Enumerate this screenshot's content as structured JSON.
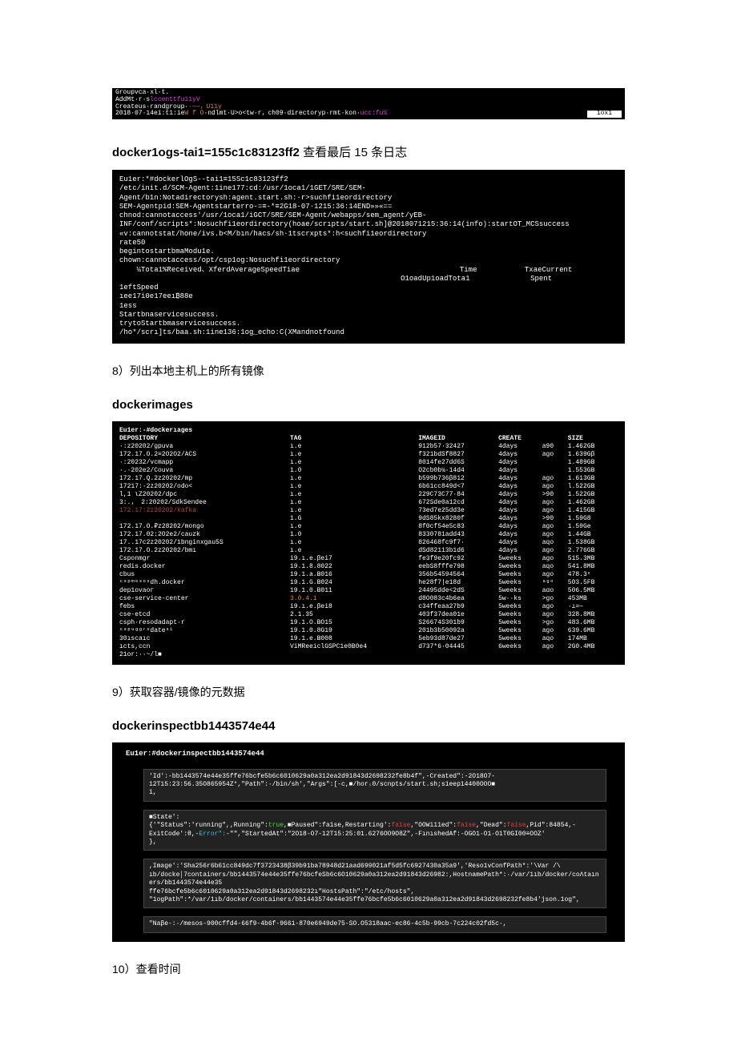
{
  "topDark": {
    "l1": "Groupvca·xl·t.",
    "l2a": "AddMt·r·s",
    "l2b": "lccenttfu11yV",
    "l3a": "Createus·randgroup·",
    "l3b": "·——，U11y",
    "l4a": "2018·07·14ei:t1:ie",
    "l4b": "W f O",
    "l4c": "·ndlmt·U>o<tw·r，ch09·directoryp·rmt·kon·",
    "l4d": "ucc:fu%",
    "right": "1ox1"
  },
  "title1_bold": "docker1ogs-tai1=155c1c83123ff2 ",
  "title1_rest": "查看最后 15 条日志",
  "logs": [
    "Eu1er:*#dockerlOgS--tai1≡15Sc1c83123ff2",
    "/etc/init.d/SCM-Agent:1ine177:cd:/usr/1oca1/1GET/SRE/SEM-Agent/b1n:Notadirectorysh:agent.start.sh:·r>suchfi1eordirectory",
    "SEM-Agentpid:SEM-Agentstarterro-=≡-*≡2G18-07·1215:36:14END»»«==",
    "chnod:cannotaccess'/usr/1oca1/iGCT/SRE/SEM-Agent/webapps/sem_agent/yEB-",
    "INF/conf/scripts*:Nosuchfi1eordirectory(hoae/scrıpts/start.sh]@2018071215:36:14(info):startOT_MCSsuccess",
    "«v:cannotstat/hone/ivs.b<M/bın/hacs/sh·1tscrxpts*:h<suchfi1eordirectory",
    "rate50",
    "begintostartbmaModu1e.",
    "chown:cannotaccess/opt/csp1og:Nosuchfi1eordirectory",
    "    ¼Tota1%Received、XferdAverageSpeedTiae                                     Time           TxaeCurrent",
    "                                                                 O1oadUp1oadTota1              Spent        1eftSpeed",
    "ıee17i0e17eeı₿88e                                                                                                     1ess",
    "Startbnaservicesuccess.",
    "trytoStartbmaservicesuccess.",
    "/ho*/scrı]ts/baa.sh:1ine136:1og_echo:C(XMandnotfound"
  ],
  "sub8": "8）列出本地主机上的所有镜像",
  "head_images": "dockerimages",
  "images_cmd": "Eu1er:-#dockerıages",
  "images_cols": [
    "DEPOSITORY",
    "TAG",
    "IMAGEID",
    "CREATE",
    "",
    "SIZE"
  ],
  "images": [
    [
      "·:z20202/gpuva",
      "ı.e",
      "912b57·32427",
      "4days",
      "a90",
      "1.462GB"
    ],
    [
      "172.17.O.2≡2O2O2/ACS",
      "ı.e",
      "f321bdSf8827",
      "4days",
      "ago",
      "1.639Gβ"
    ],
    [
      "·:20232/vcmapp",
      "ı.e",
      "8014fe27dd6S",
      "4days",
      "",
      "1.489GB"
    ],
    [
      "·.·202e2/Couva",
      "1.0",
      "O2cb0b¼·14d4",
      "4days",
      "",
      "1.553GB"
    ],
    [
      "172.17.Q.2z20202/mp",
      "ı.e",
      "b599b736β812",
      "4days",
      "ago",
      "1.613GB"
    ],
    [
      "17217:·2z20202/odo<",
      "ı.e",
      "6b61cc849d<7",
      "4days",
      "ago",
      "l.522GB"
    ],
    [
      "l,1        ιZ20202/dpc",
      "ı.e",
      "229C73C77·84",
      "4days",
      ">90",
      "1.522GB"
    ],
    [
      "3:.，      2:20202/SdkSendee",
      "ı.e",
      "672Sde0a12cd",
      "4days",
      "ago",
      "1.462GB"
    ],
    [
      "172.17:2z20202/kafka",
      "ı.e",
      "73ed7e25dd3e",
      "4days",
      "ago",
      "1.415GB",
      "red"
    ],
    [
      "",
      "1.G",
      "9dS85kx8280f",
      "4days",
      ">90",
      "1.59G8"
    ],
    [
      "172.17.O.₽z28202/mongo",
      "ı.e",
      "8f0cf54e5c83",
      "4days",
      "ago",
      "1.59Ge"
    ],
    [
      "172.17.02:2O2e2/cauzk",
      "1.0",
      "8330781add43",
      "4days",
      "ago",
      "1.44GB"
    ],
    [
      "17..17c2z20202/1bnginxgau5S",
      "ı.e",
      "826468fc9f7·",
      "4days",
      "aqo",
      "1.538GB"
    ],
    [
      "172.17.O.2z20202/bmı",
      "ı.e",
      "dSd82113b1d6",
      "4days",
      "ago",
      "2.776GB"
    ],
    [
      "Csponmgr",
      "i9.ı.e.βei7",
      "fe3f9e20fc92",
      "5weeks",
      "ago",
      "515.3MB"
    ],
    [
      "redis.docker",
      "19.1.8.8022",
      "eebS8fffe798",
      "5weeks",
      "aqo",
      "541.8MB"
    ],
    [
      "cbus",
      "19.1.a.B016",
      "356b54594564",
      "5weeks",
      "ago",
      "478.3ˣ"
    ],
    [
      "ᶜˢᵖᵐᵉˢᵒˢdh.docker",
      "19.1.G.B024",
      "he28f7|e18d",
      "5weeks",
      "ᵃᵍᵒ",
      "503.5FB"
    ],
    [
      "dep1ovaoг",
      "19.1.0.B011",
      "24495dde<2dS",
      "5weeks",
      "aαo",
      "506.5MB"
    ],
    [
      "cse-service-center",
      "3.0.4.1",
      "d8O083c4b6ea",
      "5w··ks",
      ">go",
      "453MB",
      "orange"
    ],
    [
      "febs",
      "i9.ı.e.βei8",
      "c34ffeaa27b9",
      "5weeks",
      "ago",
      "·⊥=—"
    ],
    [
      "cse-etcd",
      "2.1.35",
      "403f37dea01e",
      "5weeks",
      "ago",
      "328.8MB"
    ],
    [
      "csph·resodadapt·r",
      "19.1.O.BO15",
      "S26674S301b9",
      "5weeks",
      ">go",
      "483.6MB"
    ],
    [
      "ᶜˢᵖᵘᵍᵍʳᵉdateˢ¹",
      "19.1.0.8G19",
      "201b3b50092a",
      "5weeks",
      "ago",
      "639.6MB"
    ],
    [
      "30ıscaıc",
      "19.1.e.B008",
      "5eb93d87de27",
      "5weeks",
      "aqo",
      "174MB"
    ],
    [
      "ıcts,ccn",
      "ViMReeiclGSPC1e0B0e4",
      "d737*6·04445",
      "6weeks",
      "ago",
      "2G0.4MB"
    ],
    [
      "21or:··~/l■",
      "",
      "",
      "",
      "",
      ""
    ]
  ],
  "sub9": "9）获取容器/镜像的元数据",
  "head_inspect": "dockerinspectbb1443574e44",
  "inspect_cmd": "Eu1er:#dockerinspectbb1443574e44",
  "ins_b1_l1": "'Id':-bb1443574e44e35ffe76bcfe5b6c6010629a0a312ea2d91843d2698232fe8b4f\",-Created\":-2O18O7-12T15:23:56.35O865954Z°,\"Path\":·/bin/sh',\"Args\":[-c,■/horᵢ0/scnpts/start.sh;s1eep14400OOO■",
  "ins_b1_l2": "1,",
  "ins_b2_a": "■State':{'\"Status\":'running\",,Running\":",
  "ins_b2_b": "true",
  "ins_b2_c": ",■Paused\":fa1se,Restarting':",
  "ins_b2_d": "fa1se",
  "ins_b2_e": ",\"OOWi11ed\":",
  "ins_b2_f": "fa1se",
  "ins_b2_g": ",\"Dead\":",
  "ins_b2_h": "fa1se",
  "ins_b2_i": ",Pid\":84854,-",
  "ins_b2_l2a": "     ExitCode':θ,-",
  "ins_b2_l2b": "Error\":",
  "ins_b2_l2c": "-\"\",\"StartedAt\":\"2O18-O7-12T15:25:01.6276OO9O8Z\",-FınıshedAf:-OGO1·O1·O1T0GI00≡OOZ'",
  "ins_b2_l3": "},",
  "ins_b3_l1": ",Image':'Sha256r6b61cc849dc7f3723438β39b91ba78948d21aad699021af5d5fc6927430a35a9','Reso1vConfPath*:'\\Var /\\",
  "ins_b3_l2": "ıb/docke│7containers/bb1443574e44e35ffe76bcfeSb6c6O10629a0a312ea2d91843d26982:,HostnamePath*:·/var/1ıb/docker/coΛtaıners/bb1443574e44e35",
  "ins_b3_l3": "ffe76bcfe5b6c6010629a0a312ea2d91843d2698232ı\"HostsPath\":\"/etc/hosts\",",
  "ins_b3_l4": "\"1ogPath\":*/var/1ıb/docker/containers/bb1443574e44e35ffe76bcfe5b6c6010629a0a312ea2d91843d2698232fe8b4'json.1og\",",
  "ins_b4": "\"Naβe-:·/mesos-900cffd4-66f9-4b6f-9661-870e6949de75-SO.O5318aac-ec86-4c5b-99cb-7c224c02fd5c·,",
  "sub10": "10）查看时间"
}
